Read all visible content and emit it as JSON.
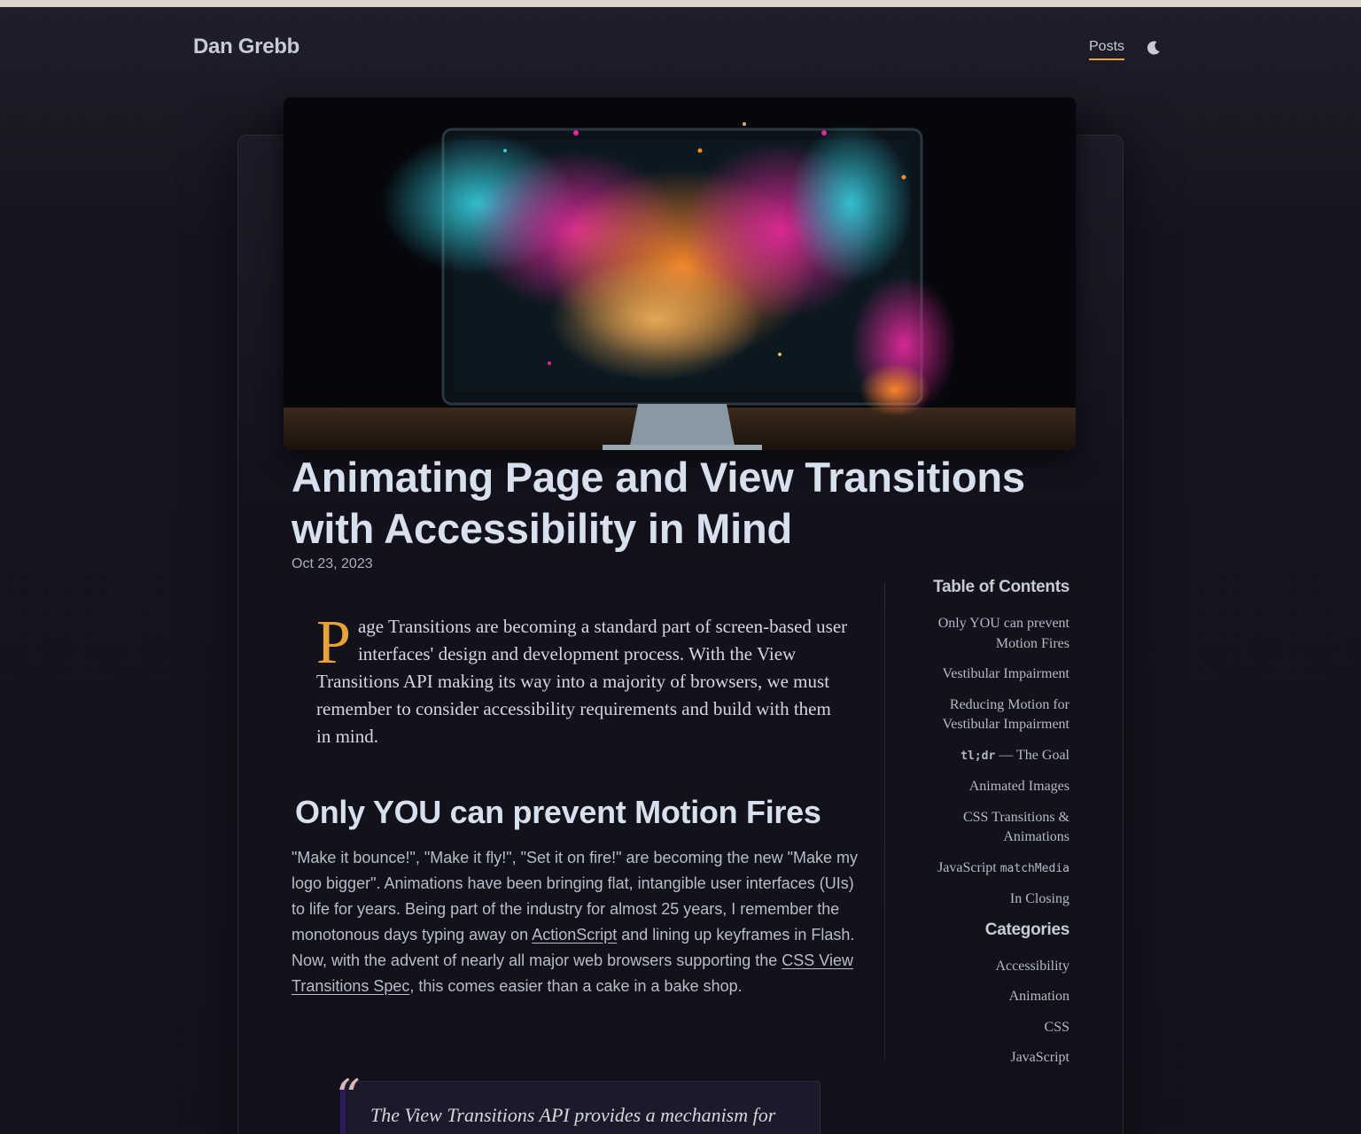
{
  "site": {
    "title": "Dan Grebb"
  },
  "nav": {
    "posts_label": "Posts",
    "theme_icon": "moon-icon"
  },
  "post": {
    "title": "Animating Page and View Transitions with Accessibility in Mind",
    "date": "Oct 23, 2023",
    "intro_dropcap": "P",
    "intro_rest": "age Transitions are becoming a standard part of screen-based user interfaces' design and development process. With the View Transitions API making its way into a majority of browsers, we must remember to consider accessibility requirements and build with them in mind.",
    "section_heading": "Only YOU can prevent Motion Fires",
    "para_part1": "\"Make it bounce!\", \"Make it fly!\", \"Set it on fire!\" are becoming the new \"Make my logo bigger\". Animations have been bringing flat, intangible user interfaces (UIs) to life for years. Being part of the industry for almost 25 years, I remember the monotonous days typing away on ",
    "link1": "ActionScript",
    "para_part2": " and lining up keyframes in Flash. Now, with the advent of nearly all major web browsers supporting the ",
    "link2": "CSS View Transitions Spec",
    "para_part3": ", this comes easier than a cake in a bake shop.",
    "quote_mark": "“",
    "quote_text": "The View Transitions API provides a mechanism for"
  },
  "toc": {
    "heading": "Table of Contents",
    "items": [
      "Only YOU can prevent Motion Fires",
      "Vestibular Impairment",
      "Reducing Motion for Vestibular Impairment",
      {
        "code": "tl;dr",
        "text": " — The Goal"
      },
      "Animated Images",
      "CSS Transitions & Animations",
      {
        "text": "JavaScript ",
        "code": "matchMedia"
      },
      "In Closing"
    ]
  },
  "categories": {
    "heading": "Categories",
    "items": [
      "Accessibility",
      "Animation",
      "CSS",
      "JavaScript"
    ]
  },
  "colors": {
    "accent": "#e8a23a",
    "background": "#16151f",
    "heading": "#d8e0ee"
  }
}
